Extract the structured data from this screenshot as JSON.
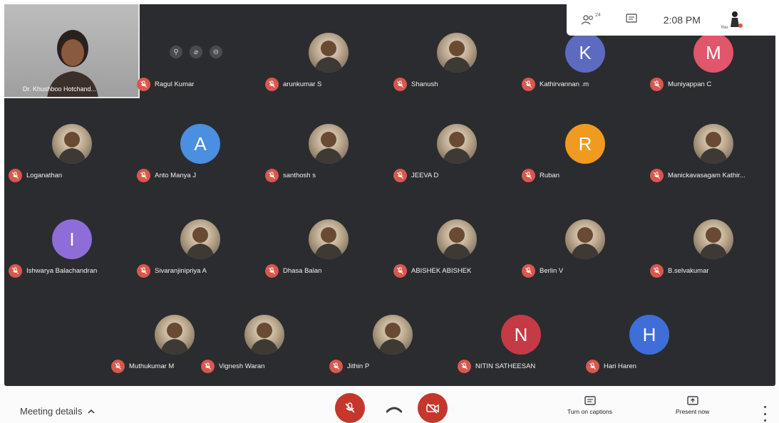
{
  "self": {
    "name": "Dr. Khushboo Hotchand..."
  },
  "participants_row1": [
    {
      "name": "Ragul Kumar",
      "avatar": "",
      "type": "none"
    },
    {
      "name": "arunkumar S",
      "avatar": "",
      "type": "photo"
    },
    {
      "name": "Shanush",
      "avatar": "",
      "type": "photo"
    },
    {
      "name": "Kathirvannan .m",
      "avatar": "K",
      "type": "letter",
      "color": "#5c6bc0"
    },
    {
      "name": "Muniyappan C",
      "avatar": "M",
      "type": "letter",
      "color": "#e0566a"
    }
  ],
  "participants_row2": [
    {
      "name": "Loganathan",
      "avatar": "",
      "type": "photo"
    },
    {
      "name": "Anto Manya J",
      "avatar": "A",
      "type": "letter",
      "color": "#4a8fe0"
    },
    {
      "name": "santhosh s",
      "avatar": "",
      "type": "photo"
    },
    {
      "name": "JEEVA D",
      "avatar": "",
      "type": "photo"
    },
    {
      "name": "Ruban",
      "avatar": "R",
      "type": "letter",
      "color": "#f09a1f"
    },
    {
      "name": "Manickavasagam Kathir...",
      "avatar": "",
      "type": "photo"
    }
  ],
  "participants_row3": [
    {
      "name": "Ishwarya Balachandran",
      "avatar": "I",
      "type": "letter",
      "color": "#8e6dd8"
    },
    {
      "name": "Sivaranjinipriya A",
      "avatar": "",
      "type": "photo"
    },
    {
      "name": "Dhasa Balan",
      "avatar": "",
      "type": "photo"
    },
    {
      "name": "ABISHEK ABISHEK",
      "avatar": "",
      "type": "photo"
    },
    {
      "name": "Berlin V",
      "avatar": "",
      "type": "photo"
    },
    {
      "name": "B.selvakumar",
      "avatar": "",
      "type": "photo"
    }
  ],
  "participants_row4": [
    {
      "name": "Muthukumar M",
      "avatar": "",
      "type": "photo"
    },
    {
      "name": "Vignesh Waran",
      "avatar": "",
      "type": "photo"
    },
    {
      "name": "Jithin P",
      "avatar": "",
      "type": "photo"
    },
    {
      "name": "NITIN SATHEESAN",
      "avatar": "N",
      "type": "letter",
      "color": "#c53a45"
    },
    {
      "name": "Hari Haren",
      "avatar": "H",
      "type": "letter",
      "color": "#3f6ed8"
    }
  ],
  "topbar": {
    "participant_count": "24",
    "time": "2:08 PM",
    "you_label": "You"
  },
  "bottombar": {
    "meeting_details": "Meeting details",
    "captions": "Turn on captions",
    "present": "Present now"
  },
  "colors": {
    "grid_bg": "#2b2c2f",
    "mic_off": "#d8584d",
    "control_red": "#c5362c"
  }
}
